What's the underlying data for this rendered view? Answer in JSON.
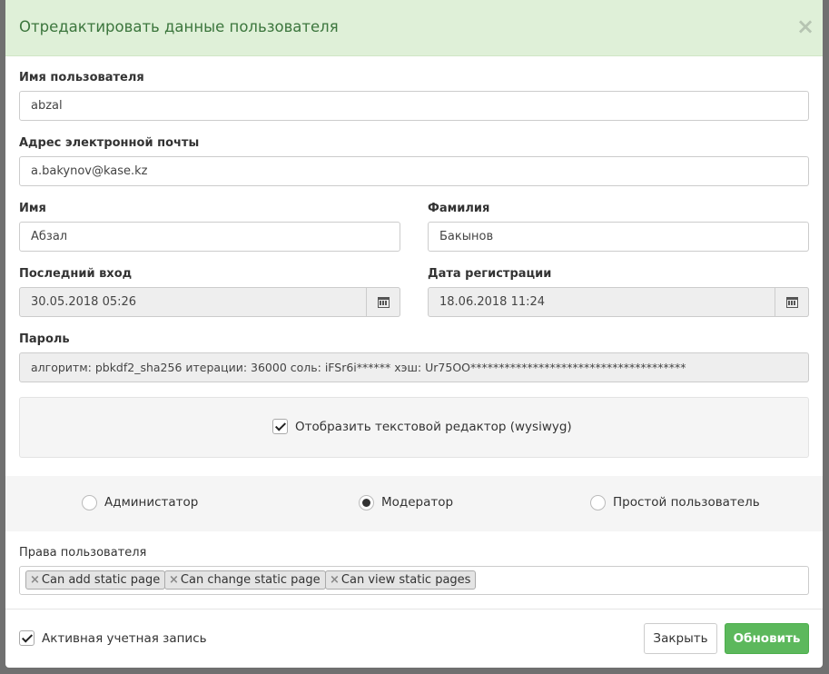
{
  "modal": {
    "title": "Отредактировать данные пользователя",
    "close_symbol": "×"
  },
  "form": {
    "username": {
      "label": "Имя пользователя",
      "value": "abzal"
    },
    "email": {
      "label": "Адрес электронной почты",
      "value": "a.bakynov@kase.kz"
    },
    "first_name": {
      "label": "Имя",
      "value": "Абзал"
    },
    "last_name": {
      "label": "Фамилия",
      "value": "Бакынов"
    },
    "last_login": {
      "label": "Последний вход",
      "value": "30.05.2018 05:26",
      "icon": "calendar-icon"
    },
    "date_joined": {
      "label": "Дата регистрации",
      "value": "18.06.2018 11:24",
      "icon": "calendar-icon"
    },
    "password": {
      "label": "Пароль",
      "value": "алгоритм: pbkdf2_sha256 итерации: 36000 соль: iFSr6i****** хэш: Ur75OO**************************************"
    },
    "wysiwyg": {
      "label": "Отобразить текстовой редактор (wysiwyg)",
      "checked": true
    },
    "roles": {
      "options": [
        {
          "label": "Администатор",
          "checked": false
        },
        {
          "label": "Модератор",
          "checked": true
        },
        {
          "label": "Простой пользователь",
          "checked": false
        }
      ]
    },
    "permissions": {
      "label": "Права пользователя",
      "remove_symbol": "×",
      "tags": [
        "Can add static page",
        "Can change static page",
        "Can view static pages"
      ]
    },
    "active": {
      "label": "Активная учетная запись",
      "checked": true
    }
  },
  "buttons": {
    "close_label": "Закрыть",
    "update_label": "Обновить"
  },
  "colors": {
    "header_bg": "#dff0d8",
    "header_text": "#3c763d",
    "primary_button": "#5cb85c"
  }
}
